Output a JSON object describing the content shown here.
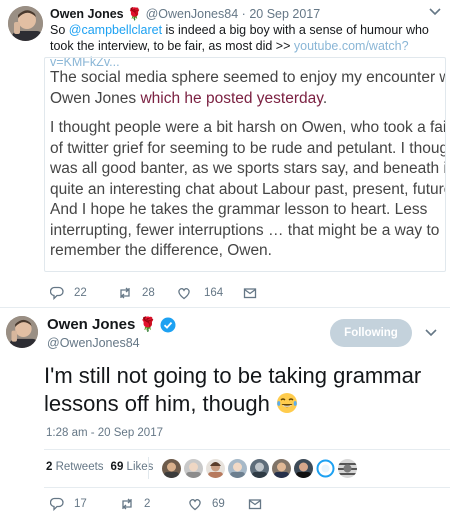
{
  "tweet1": {
    "author_name": "Owen Jones",
    "author_handle": "@OwenJones84",
    "date": "20 Sep 2017",
    "separator": "·",
    "text_before": "So ",
    "mention": "@campbellclaret",
    "text_after": " is indeed a big boy with a sense of humour who took the interview, to be fair, as most did >> ",
    "link": "youtube.com/watch?v=KMFkZv...",
    "quote": {
      "p1_line1": "The social media sphere seemed to enjoy my encounter with",
      "p1_line2_plain": "Owen Jones ",
      "p1_line2_link": "which he posted yesterday",
      "p1_line2_end": ".",
      "p2_lines": [
        "I thought people were a bit harsh on Owen, who took a fair b",
        "of twitter grief for seeming to be rude and petulant. I thought",
        "was all good banter, as we sports stars say, and beneath it",
        "quite an interesting chat about Labour past, present, future.",
        "And I hope he takes the grammar lesson to heart. Less",
        "interrupting, fewer interruptions … that might be a way to",
        "remember the difference, Owen."
      ]
    },
    "actions": {
      "replies": "22",
      "retweets": "28",
      "likes": "164"
    }
  },
  "tweet2": {
    "author_name": "Owen Jones",
    "author_handle": "@OwenJones84",
    "follow_label": "Following",
    "text": "I'm still not going to be taking grammar lessons off him, though",
    "emoji": "face-with-tears-of-joy",
    "timestamp": "1:28 am - 20 Sep 2017",
    "stats": {
      "retweets_count": "2",
      "retweets_label": "Retweets",
      "likes_count": "69",
      "likes_label": "Likes"
    },
    "actions": {
      "replies": "17",
      "retweets": "2",
      "likes": "69"
    }
  },
  "colors": {
    "accent_blue": "#1da1f2",
    "muted": "#657786",
    "rose_red": "#b3001b",
    "following_button": "#c4d2dc",
    "quote_link": "#7b2142"
  },
  "icons": [
    "reply-icon",
    "retweet-icon",
    "heart-icon",
    "mail-icon",
    "chevron-down-icon",
    "verified-badge-icon",
    "rose-icon"
  ]
}
